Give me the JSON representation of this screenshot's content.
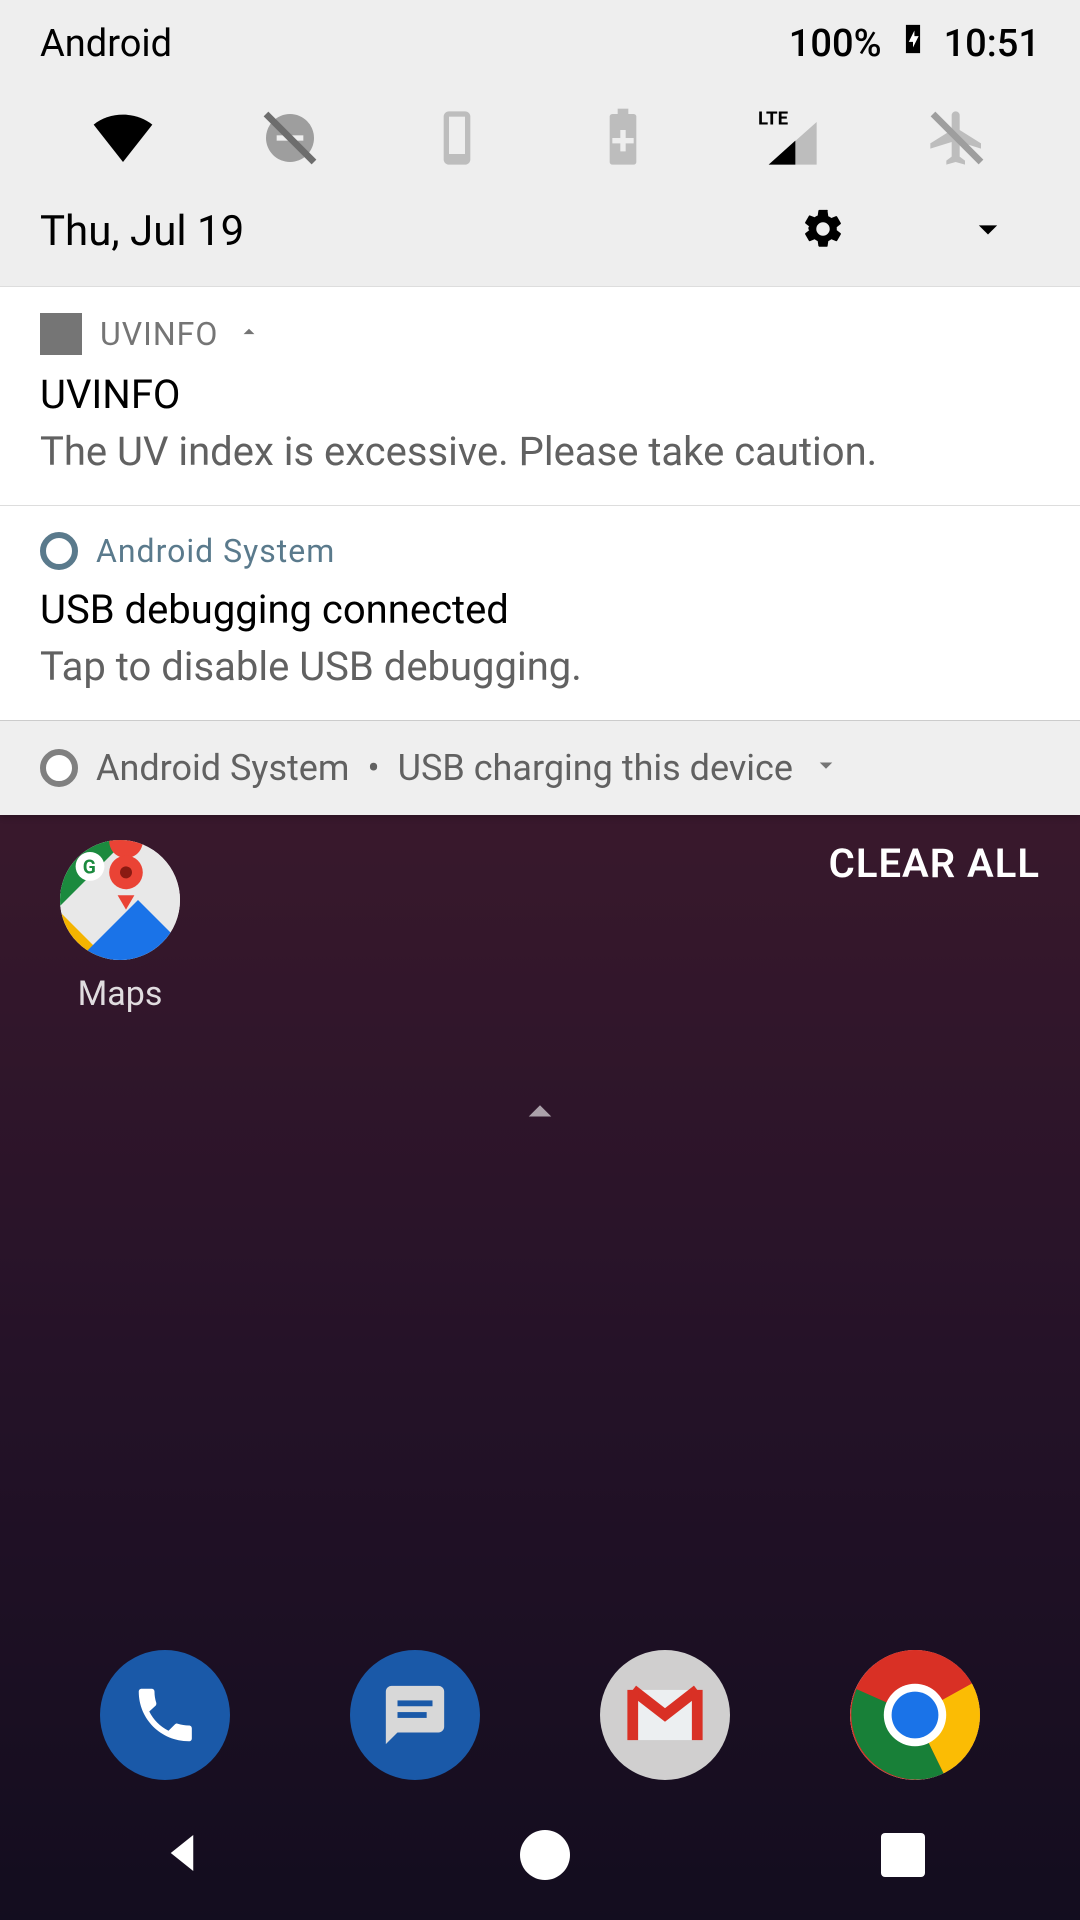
{
  "status": {
    "carrier": "Android",
    "battery_pct": "100%",
    "time": "10:51"
  },
  "qs": {
    "date": "Thu, Jul 19",
    "tiles": {
      "wifi": "wifi",
      "dnd": "dnd-off",
      "portrait": "portrait",
      "battery": "battery-saver",
      "cellular": "LTE",
      "airplane": "airplane-off"
    }
  },
  "notifications": [
    {
      "app": "UVINFO",
      "title": "UVINFO",
      "body": "The UV index is excessive. Please take caution."
    },
    {
      "app": "Android System",
      "title": "USB debugging connected",
      "body": "Tap to disable USB debugging."
    }
  ],
  "ongoing": {
    "app": "Android System",
    "summary": "USB charging this device"
  },
  "clear_all": "CLEAR ALL",
  "home": {
    "maps_label": "Maps"
  }
}
